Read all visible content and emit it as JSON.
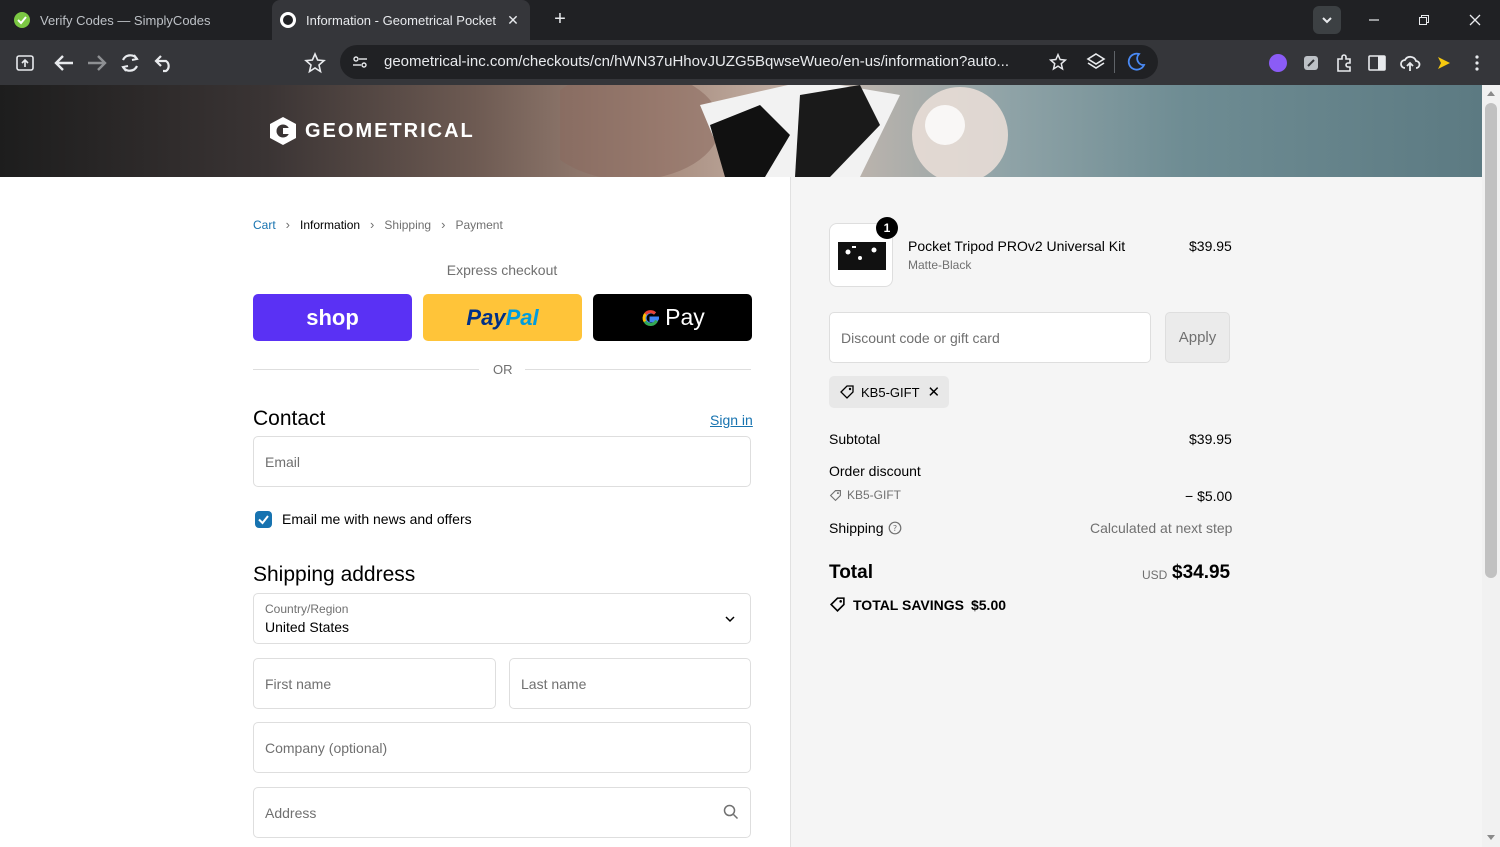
{
  "browser": {
    "tabs": [
      {
        "title": "Verify Codes — SimplyCodes",
        "active": false
      },
      {
        "title": "Information - Geometrical Pocket",
        "active": true
      }
    ],
    "url": "geometrical-inc.com/checkouts/cn/hWN37uHhovJUZG5BqwseWueo/en-us/information?auto..."
  },
  "header": {
    "logo_text": "GEOMETRICAL"
  },
  "breadcrumb": {
    "items": [
      "Cart",
      "Information",
      "Shipping",
      "Payment"
    ]
  },
  "express": {
    "title": "Express checkout",
    "shop_label": "shop",
    "paypal_label_a": "Pay",
    "paypal_label_b": "Pal",
    "gpay_label": "Pay",
    "or": "OR"
  },
  "contact": {
    "heading": "Contact",
    "signin": "Sign in",
    "email_placeholder": "Email",
    "newsletter_label": "Email me with news and offers",
    "newsletter_checked": true
  },
  "shipping_address": {
    "heading": "Shipping address",
    "country_label": "Country/Region",
    "country_value": "United States",
    "first_name_placeholder": "First name",
    "last_name_placeholder": "Last name",
    "company_placeholder": "Company (optional)",
    "address_placeholder": "Address"
  },
  "summary": {
    "item": {
      "name": "Pocket Tripod PROv2 Universal Kit",
      "variant": "Matte-Black",
      "price": "$39.95",
      "quantity": "1"
    },
    "discount_placeholder": "Discount code or gift card",
    "apply": "Apply",
    "applied_code": "KB5-GIFT",
    "subtotal_label": "Subtotal",
    "subtotal_value": "$39.95",
    "order_discount_label": "Order discount",
    "order_discount_code": "KB5-GIFT",
    "order_discount_value": "− $5.00",
    "shipping_label": "Shipping",
    "shipping_value": "Calculated at next step",
    "total_label": "Total",
    "currency": "USD",
    "total_value": "$34.95",
    "savings_label": "TOTAL SAVINGS",
    "savings_value": "$5.00"
  }
}
